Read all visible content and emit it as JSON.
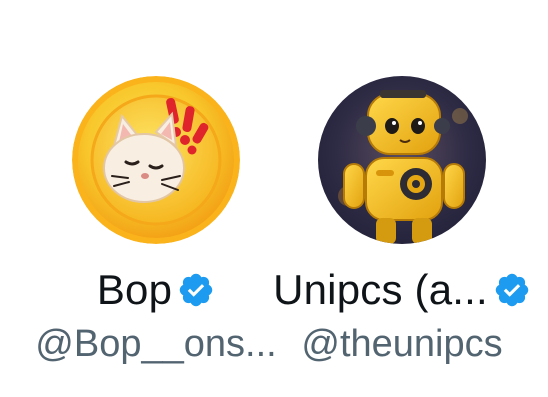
{
  "accounts": [
    {
      "display_name": "Bop",
      "handle": "@Bop__ons...",
      "verified": true,
      "avatar_icon": "cat-coin-avatar",
      "avatar_colors": {
        "rim": "#f5a81c",
        "face": "#fbd43a",
        "alert": "#e0242b"
      }
    },
    {
      "display_name": "Unipcs (a...",
      "handle": "@theunipcs",
      "verified": true,
      "avatar_icon": "yellow-robot-avatar",
      "avatar_colors": {
        "body": "#f2b81b",
        "background": "#2d2a44"
      }
    }
  ],
  "colors": {
    "name_text": "#0f1419",
    "handle_text": "#536471",
    "verified_blue": "#1d9bf0"
  }
}
